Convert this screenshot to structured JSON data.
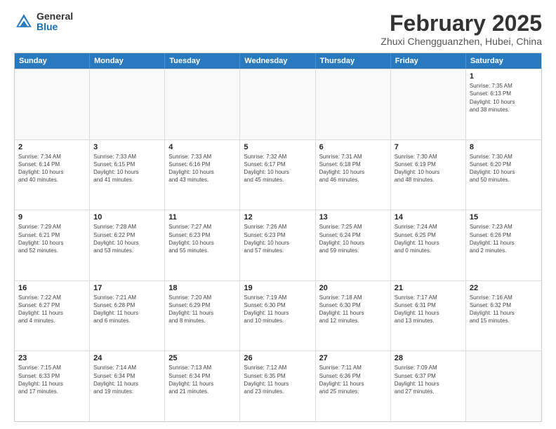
{
  "header": {
    "logo_general": "General",
    "logo_blue": "Blue",
    "month_title": "February 2025",
    "subtitle": "Zhuxi Chengguanzhen, Hubei, China"
  },
  "days_of_week": [
    "Sunday",
    "Monday",
    "Tuesday",
    "Wednesday",
    "Thursday",
    "Friday",
    "Saturday"
  ],
  "weeks": [
    [
      {
        "day": "",
        "info": ""
      },
      {
        "day": "",
        "info": ""
      },
      {
        "day": "",
        "info": ""
      },
      {
        "day": "",
        "info": ""
      },
      {
        "day": "",
        "info": ""
      },
      {
        "day": "",
        "info": ""
      },
      {
        "day": "1",
        "info": "Sunrise: 7:35 AM\nSunset: 6:13 PM\nDaylight: 10 hours\nand 38 minutes."
      }
    ],
    [
      {
        "day": "2",
        "info": "Sunrise: 7:34 AM\nSunset: 6:14 PM\nDaylight: 10 hours\nand 40 minutes."
      },
      {
        "day": "3",
        "info": "Sunrise: 7:33 AM\nSunset: 6:15 PM\nDaylight: 10 hours\nand 41 minutes."
      },
      {
        "day": "4",
        "info": "Sunrise: 7:33 AM\nSunset: 6:16 PM\nDaylight: 10 hours\nand 43 minutes."
      },
      {
        "day": "5",
        "info": "Sunrise: 7:32 AM\nSunset: 6:17 PM\nDaylight: 10 hours\nand 45 minutes."
      },
      {
        "day": "6",
        "info": "Sunrise: 7:31 AM\nSunset: 6:18 PM\nDaylight: 10 hours\nand 46 minutes."
      },
      {
        "day": "7",
        "info": "Sunrise: 7:30 AM\nSunset: 6:19 PM\nDaylight: 10 hours\nand 48 minutes."
      },
      {
        "day": "8",
        "info": "Sunrise: 7:30 AM\nSunset: 6:20 PM\nDaylight: 10 hours\nand 50 minutes."
      }
    ],
    [
      {
        "day": "9",
        "info": "Sunrise: 7:29 AM\nSunset: 6:21 PM\nDaylight: 10 hours\nand 52 minutes."
      },
      {
        "day": "10",
        "info": "Sunrise: 7:28 AM\nSunset: 6:22 PM\nDaylight: 10 hours\nand 53 minutes."
      },
      {
        "day": "11",
        "info": "Sunrise: 7:27 AM\nSunset: 6:23 PM\nDaylight: 10 hours\nand 55 minutes."
      },
      {
        "day": "12",
        "info": "Sunrise: 7:26 AM\nSunset: 6:23 PM\nDaylight: 10 hours\nand 57 minutes."
      },
      {
        "day": "13",
        "info": "Sunrise: 7:25 AM\nSunset: 6:24 PM\nDaylight: 10 hours\nand 59 minutes."
      },
      {
        "day": "14",
        "info": "Sunrise: 7:24 AM\nSunset: 6:25 PM\nDaylight: 11 hours\nand 0 minutes."
      },
      {
        "day": "15",
        "info": "Sunrise: 7:23 AM\nSunset: 6:26 PM\nDaylight: 11 hours\nand 2 minutes."
      }
    ],
    [
      {
        "day": "16",
        "info": "Sunrise: 7:22 AM\nSunset: 6:27 PM\nDaylight: 11 hours\nand 4 minutes."
      },
      {
        "day": "17",
        "info": "Sunrise: 7:21 AM\nSunset: 6:28 PM\nDaylight: 11 hours\nand 6 minutes."
      },
      {
        "day": "18",
        "info": "Sunrise: 7:20 AM\nSunset: 6:29 PM\nDaylight: 11 hours\nand 8 minutes."
      },
      {
        "day": "19",
        "info": "Sunrise: 7:19 AM\nSunset: 6:30 PM\nDaylight: 11 hours\nand 10 minutes."
      },
      {
        "day": "20",
        "info": "Sunrise: 7:18 AM\nSunset: 6:30 PM\nDaylight: 11 hours\nand 12 minutes."
      },
      {
        "day": "21",
        "info": "Sunrise: 7:17 AM\nSunset: 6:31 PM\nDaylight: 11 hours\nand 13 minutes."
      },
      {
        "day": "22",
        "info": "Sunrise: 7:16 AM\nSunset: 6:32 PM\nDaylight: 11 hours\nand 15 minutes."
      }
    ],
    [
      {
        "day": "23",
        "info": "Sunrise: 7:15 AM\nSunset: 6:33 PM\nDaylight: 11 hours\nand 17 minutes."
      },
      {
        "day": "24",
        "info": "Sunrise: 7:14 AM\nSunset: 6:34 PM\nDaylight: 11 hours\nand 19 minutes."
      },
      {
        "day": "25",
        "info": "Sunrise: 7:13 AM\nSunset: 6:34 PM\nDaylight: 11 hours\nand 21 minutes."
      },
      {
        "day": "26",
        "info": "Sunrise: 7:12 AM\nSunset: 6:35 PM\nDaylight: 11 hours\nand 23 minutes."
      },
      {
        "day": "27",
        "info": "Sunrise: 7:11 AM\nSunset: 6:36 PM\nDaylight: 11 hours\nand 25 minutes."
      },
      {
        "day": "28",
        "info": "Sunrise: 7:09 AM\nSunset: 6:37 PM\nDaylight: 11 hours\nand 27 minutes."
      },
      {
        "day": "",
        "info": ""
      }
    ]
  ]
}
